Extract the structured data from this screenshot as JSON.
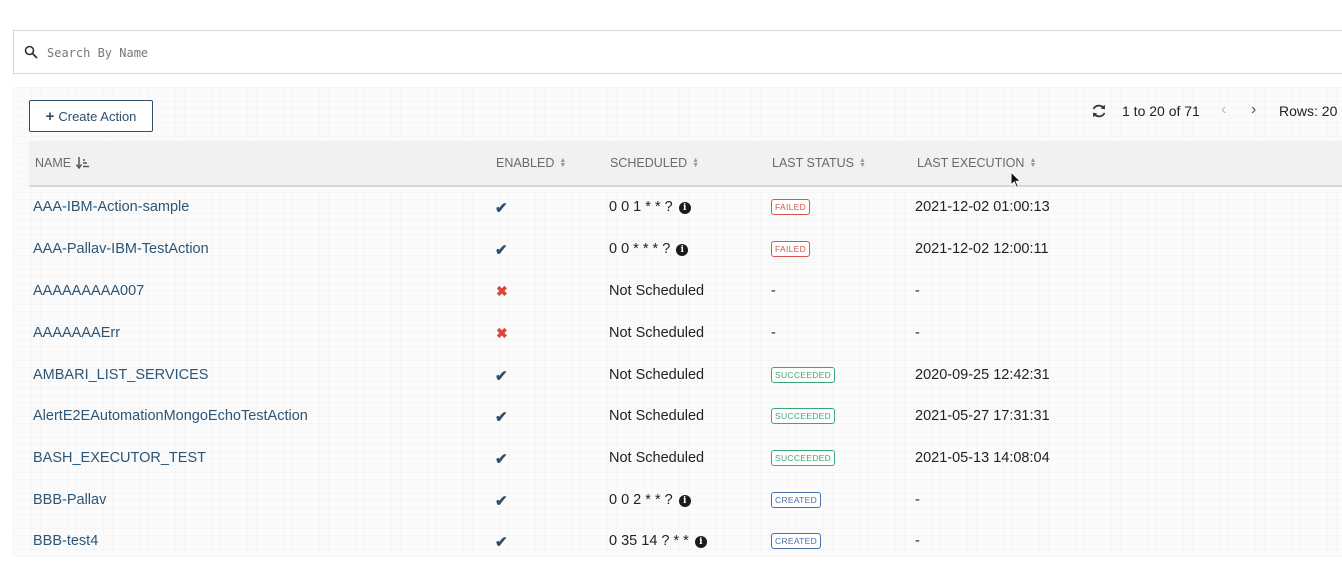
{
  "search": {
    "placeholder": "Search By Name",
    "value": ""
  },
  "toolbar": {
    "create_label": "Create Action",
    "create_icon": "plus-icon"
  },
  "pager": {
    "range": "1 to 20 of 71",
    "rows_label": "Rows: 20",
    "prev": "‹",
    "next": "›"
  },
  "columns": {
    "name": "NAME",
    "enabled": "ENABLED",
    "scheduled": "SCHEDULED",
    "last_status": "LAST STATUS",
    "last_execution": "LAST EXECUTION"
  },
  "status_colors": {
    "FAILED": "#d9534f",
    "SUCCEEDED": "#3aa876",
    "CREATED": "#4a6ea8"
  },
  "rows": [
    {
      "name": "AAA-IBM-Action-sample",
      "enabled": true,
      "scheduled": "0 0 1 * * ?",
      "has_info": true,
      "status": "FAILED",
      "last_execution": "2021-12-02 01:00:13"
    },
    {
      "name": "AAA-Pallav-IBM-TestAction",
      "enabled": true,
      "scheduled": "0 0 * * * ?",
      "has_info": true,
      "status": "FAILED",
      "last_execution": "2021-12-02 12:00:11"
    },
    {
      "name": "AAAAAAAAA007",
      "enabled": false,
      "scheduled": "Not Scheduled",
      "has_info": false,
      "status": "-",
      "last_execution": "-"
    },
    {
      "name": "AAAAAAAErr",
      "enabled": false,
      "scheduled": "Not Scheduled",
      "has_info": false,
      "status": "-",
      "last_execution": "-"
    },
    {
      "name": "AMBARI_LIST_SERVICES",
      "enabled": true,
      "scheduled": "Not Scheduled",
      "has_info": false,
      "status": "SUCCEEDED",
      "last_execution": "2020-09-25 12:42:31"
    },
    {
      "name": "AlertE2EAutomationMongoEchoTestAction",
      "enabled": true,
      "scheduled": "Not Scheduled",
      "has_info": false,
      "status": "SUCCEEDED",
      "last_execution": "2021-05-27 17:31:31"
    },
    {
      "name": "BASH_EXECUTOR_TEST",
      "enabled": true,
      "scheduled": "Not Scheduled",
      "has_info": false,
      "status": "SUCCEEDED",
      "last_execution": "2021-05-13 14:08:04"
    },
    {
      "name": "BBB-Pallav",
      "enabled": true,
      "scheduled": "0 0 2 * * ?",
      "has_info": true,
      "status": "CREATED",
      "last_execution": "-"
    },
    {
      "name": "BBB-test4",
      "enabled": true,
      "scheduled": "0 35 14 ? * *",
      "has_info": true,
      "status": "CREATED",
      "last_execution": "-"
    }
  ]
}
